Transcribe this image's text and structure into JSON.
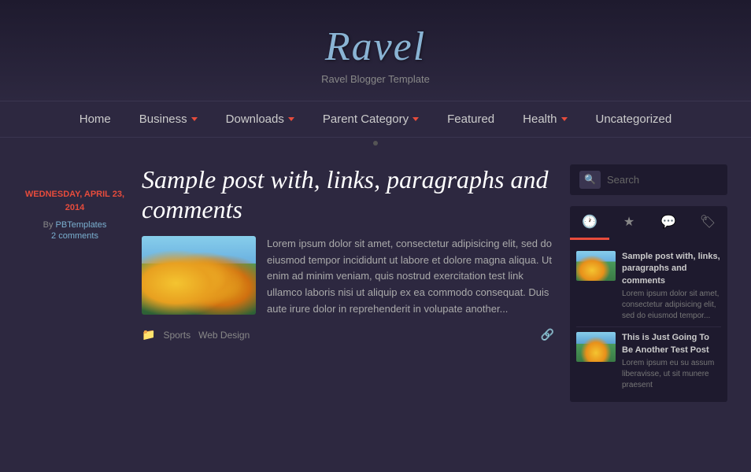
{
  "header": {
    "title": "Ravel",
    "subtitle": "Ravel Blogger Template"
  },
  "nav": {
    "items": [
      {
        "label": "Home",
        "has_dropdown": false
      },
      {
        "label": "Business",
        "has_dropdown": true
      },
      {
        "label": "Downloads",
        "has_dropdown": true
      },
      {
        "label": "Parent Category",
        "has_dropdown": true
      },
      {
        "label": "Featured",
        "has_dropdown": false
      },
      {
        "label": "Health",
        "has_dropdown": true
      },
      {
        "label": "Uncategorized",
        "has_dropdown": false
      }
    ]
  },
  "post": {
    "date": "WEDNESDAY, APRIL 23, 2014",
    "by_label": "By",
    "author": "PBTemplates",
    "comments": "2 comments",
    "title": "Sample post with, links, paragraphs and comments",
    "excerpt": "Lorem ipsum dolor sit amet, consectetur adipisicing elit, sed do eiusmod tempor incididunt ut labore et dolore magna aliqua. Ut enim ad minim veniam, quis nostrud exercitation test link ullamco laboris nisi ut aliquip ex ea commodo consequat. Duis aute irure dolor in reprehenderit in volupate another...",
    "tags": [
      "Sports",
      "Web Design"
    ]
  },
  "sidebar": {
    "search_placeholder": "Search",
    "tabs": [
      {
        "label": "🕐",
        "active": true
      },
      {
        "label": "★",
        "active": false
      },
      {
        "label": "💬",
        "active": false
      },
      {
        "label": "🏷",
        "active": false
      }
    ],
    "posts": [
      {
        "title": "Sample post with, links, paragraphs and comments",
        "excerpt": "Lorem ipsum dolor sit amet, consectetur adipisicing elit, sed do eiusmod tempor..."
      },
      {
        "title": "This is Just Going To Be Another Test Post",
        "excerpt": "Lorem ipsum eu su assum liberavisse, ut sit munere praesent"
      }
    ]
  }
}
